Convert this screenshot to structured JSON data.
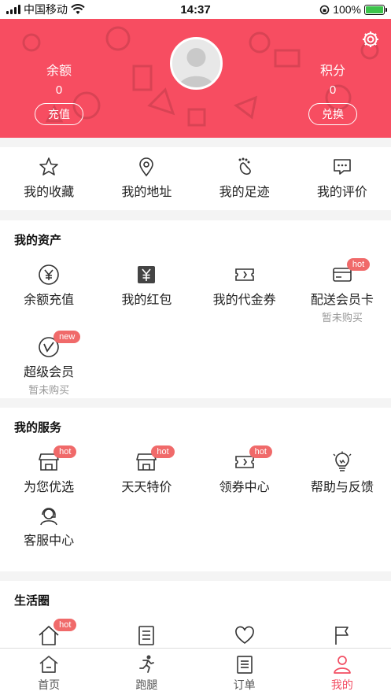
{
  "status_bar": {
    "carrier": "中国移动",
    "time": "14:37",
    "battery": "100%"
  },
  "header": {
    "balance_label": "余额",
    "balance_value": "0",
    "recharge_button": "充值",
    "points_label": "积分",
    "points_value": "0",
    "redeem_button": "兑换",
    "bg_color": "#f74d61"
  },
  "quick_links": [
    {
      "label": "我的收藏",
      "icon": "star-icon"
    },
    {
      "label": "我的地址",
      "icon": "location-pin-icon"
    },
    {
      "label": "我的足迹",
      "icon": "footprint-icon"
    },
    {
      "label": "我的评价",
      "icon": "comment-icon"
    }
  ],
  "assets": {
    "title": "我的资产",
    "items": [
      {
        "label": "余额充值",
        "icon": "yen-circle-icon"
      },
      {
        "label": "我的红包",
        "icon": "red-envelope-icon"
      },
      {
        "label": "我的代金券",
        "icon": "voucher-icon"
      },
      {
        "label": "配送会员卡",
        "icon": "card-icon",
        "badge": "hot",
        "sub": "暂未购买"
      },
      {
        "label": "超级会员",
        "icon": "super-vip-icon",
        "badge": "new",
        "sub": "暂未购买"
      }
    ]
  },
  "services": {
    "title": "我的服务",
    "items": [
      {
        "label": "为您优选",
        "icon": "shop-icon",
        "badge": "hot"
      },
      {
        "label": "天天特价",
        "icon": "shop-icon",
        "badge": "hot"
      },
      {
        "label": "领券中心",
        "icon": "coupon-icon",
        "badge": "hot"
      },
      {
        "label": "帮助与反馈",
        "icon": "lightbulb-icon"
      },
      {
        "label": "客服中心",
        "icon": "customer-service-icon"
      }
    ]
  },
  "life": {
    "title": "生活圈",
    "items": [
      {
        "icon": "home-icon",
        "badge": "hot"
      },
      {
        "icon": "document-icon"
      },
      {
        "icon": "heart-icon"
      },
      {
        "icon": "flag-icon"
      }
    ]
  },
  "tabbar": [
    {
      "label": "首页",
      "icon": "home-icon"
    },
    {
      "label": "跑腿",
      "icon": "runner-icon"
    },
    {
      "label": "订单",
      "icon": "order-icon"
    },
    {
      "label": "我的",
      "icon": "user-icon",
      "active": true
    }
  ],
  "colors": {
    "accent": "#f24d62",
    "badge": "#f06a6a"
  }
}
